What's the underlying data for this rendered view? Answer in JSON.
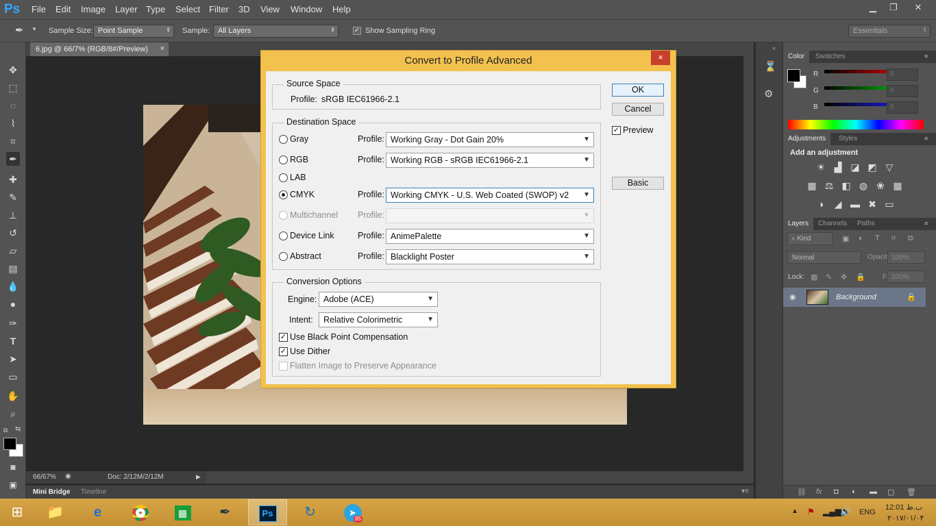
{
  "app": {
    "logo": "Ps",
    "menu": [
      "File",
      "Edit",
      "Image",
      "Layer",
      "Type",
      "Select",
      "Filter",
      "3D",
      "View",
      "Window",
      "Help"
    ],
    "window_controls": {
      "minimize": "▁",
      "restore": "❐",
      "close": "✕"
    }
  },
  "options_bar": {
    "sample_size_label": "Sample Size:",
    "sample_size_value": "Point Sample",
    "sample_label": "Sample:",
    "sample_value": "All Layers",
    "show_sampling_ring_label": "Show Sampling Ring",
    "show_sampling_ring_checked": true,
    "workspace": "Essentials"
  },
  "document": {
    "tab_title": "6.jpg @ 66/7% (RGB/8#/Preview)",
    "tab_close": "×",
    "zoom": "66/67%",
    "doc_info": "Doc: 2/12M/2/12M"
  },
  "bottom_tabs": [
    "Mini Bridge",
    "Timeline"
  ],
  "color_panel": {
    "tabs": [
      "Color",
      "Swatches"
    ],
    "channels": [
      {
        "label": "R",
        "value": "0"
      },
      {
        "label": "G",
        "value": "0"
      },
      {
        "label": "B",
        "value": "0"
      }
    ]
  },
  "adjustments_panel": {
    "tabs": [
      "Adjustments",
      "Styles"
    ],
    "heading": "Add an adjustment"
  },
  "layers_panel": {
    "tabs": [
      "Layers",
      "Channels",
      "Paths"
    ],
    "filter_kind": "Kind",
    "blend_mode": "Normal",
    "opacity_label": "Opacity:",
    "opacity_value": "100%",
    "lock_label": "Lock:",
    "fill_label": "Fill:",
    "fill_value": "100%",
    "layers": [
      {
        "name": "Background",
        "visible": true,
        "locked": true
      }
    ]
  },
  "dialog": {
    "title": "Convert to Profile Advanced",
    "close": "×",
    "source_space": {
      "legend": "Source Space",
      "profile_label": "Profile:",
      "profile_value": "sRGB IEC61966-2.1"
    },
    "destination_space": {
      "legend": "Destination Space",
      "rows": [
        {
          "name": "Gray",
          "profile_label": "Profile:",
          "profile": "Working Gray - Dot Gain 20%",
          "selected": false,
          "enabled": true
        },
        {
          "name": "RGB",
          "profile_label": "Profile:",
          "profile": "Working RGB - sRGB IEC61966-2.1",
          "selected": false,
          "enabled": true
        },
        {
          "name": "LAB",
          "profile_label": "",
          "profile": "",
          "selected": false,
          "enabled": true
        },
        {
          "name": "CMYK",
          "profile_label": "Profile:",
          "profile": "Working CMYK - U.S. Web Coated (SWOP) v2",
          "selected": true,
          "enabled": true
        },
        {
          "name": "Multichannel",
          "profile_label": "Profile:",
          "profile": "",
          "selected": false,
          "enabled": false
        },
        {
          "name": "Device Link",
          "profile_label": "Profile:",
          "profile": "AnimePalette",
          "selected": false,
          "enabled": true
        },
        {
          "name": "Abstract",
          "profile_label": "Profile:",
          "profile": "Blacklight Poster",
          "selected": false,
          "enabled": true
        }
      ]
    },
    "conversion_options": {
      "legend": "Conversion Options",
      "engine_label": "Engine:",
      "engine_value": "Adobe (ACE)",
      "intent_label": "Intent:",
      "intent_value": "Relative Colorimetric",
      "black_point_label": "Use Black Point Compensation",
      "black_point_checked": true,
      "dither_label": "Use Dither",
      "dither_checked": true,
      "flatten_label": "Flatten Image to Preserve Appearance",
      "flatten_checked": false
    },
    "buttons": {
      "ok": "OK",
      "cancel": "Cancel",
      "basic": "Basic"
    },
    "preview_label": "Preview",
    "preview_checked": true
  },
  "taskbar": {
    "language": "ENG",
    "time": "12:01 ب.ظ",
    "date": "۲۰۱۷/۰۱/۰۴",
    "telegram_badge": "85"
  },
  "colors": {
    "ps_blue": "#31a8ff",
    "dialog_frame": "#f2c14e",
    "close_red": "#c7402b",
    "taskbar": "#cf9d40"
  }
}
